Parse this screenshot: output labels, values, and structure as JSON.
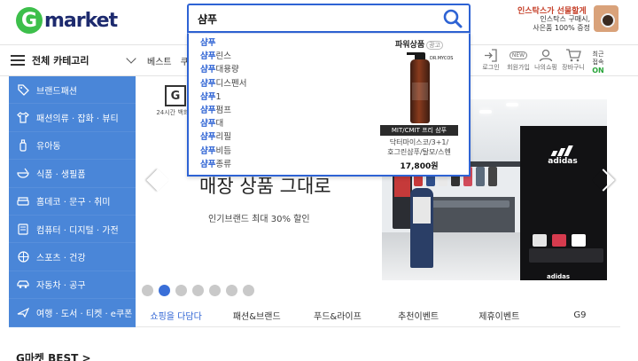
{
  "header": {
    "logo_initial": "G",
    "logo_text": "market",
    "search_value": "샴푸",
    "promo": {
      "title": "인스탁스가 선물할게",
      "line1": "인스탁스 구매시,",
      "line2": "사은품 100% 증정"
    }
  },
  "nav": {
    "all_categories": "전체 카테고리",
    "links": [
      "베스트",
      "쿠"
    ],
    "utility": [
      {
        "label": "로그인",
        "icon": "login-icon"
      },
      {
        "label": "회원가입",
        "icon": "signup-icon",
        "badge": "NEW"
      },
      {
        "label": "나의쇼핑",
        "icon": "user-icon"
      },
      {
        "label": "장바구니",
        "icon": "cart-icon"
      }
    ],
    "recent_line1": "최근",
    "recent_line2": "접속",
    "recent_on": "ON"
  },
  "categories": [
    {
      "label": "브랜드패션",
      "icon": "tag-icon"
    },
    {
      "label": "패션의류 · 잡화 · 뷰티",
      "icon": "shirt-icon"
    },
    {
      "label": "유아동",
      "icon": "bottle-icon"
    },
    {
      "label": "식품 · 생필품",
      "icon": "food-icon"
    },
    {
      "label": "홈데코 · 문구 · 취미",
      "icon": "home-icon"
    },
    {
      "label": "컴퓨터 · 디지털 · 가전",
      "icon": "monitor-icon"
    },
    {
      "label": "스포츠 · 건강",
      "icon": "ball-icon"
    },
    {
      "label": "자동차 · 공구",
      "icon": "car-icon"
    },
    {
      "label": "여행 · 도서 · 티켓 · e쿠폰",
      "icon": "plane-icon"
    }
  ],
  "banner": {
    "badge_letter": "G",
    "badge_text": "24시간 백화점",
    "title_visible": "매장 상품 그대로",
    "subtitle": "인기브랜드 최대 30% 할인",
    "slide_count": 7,
    "active_slide": 1,
    "store_logo": "adidas"
  },
  "banner_tabs": [
    "쇼핑을 다담다",
    "패션&브랜드",
    "푸드&라이프",
    "추천이벤트",
    "제휴이벤트",
    "G9"
  ],
  "best_title": "G마켓 BEST >",
  "autocomplete": {
    "keyword": "샴푸",
    "suggestions": [
      "",
      "린스",
      "대용량",
      "디스펜서",
      "1",
      "펌프",
      "대",
      "리필",
      "비듬",
      "종류"
    ],
    "ad": {
      "heading": "파워상품",
      "tag": "광고",
      "brand": "DR.MYCOS",
      "caption": "MIT/CMIT 프리 샴푸",
      "name_line1": "닥터마이스코/3+1/",
      "name_line2": "호그린샴푸/탈모/스헨",
      "price": "17,800원"
    }
  },
  "colors": {
    "accent_blue": "#2e63d4",
    "category_bg": "#4a86d8",
    "logo_green": "#3dbf4b"
  }
}
